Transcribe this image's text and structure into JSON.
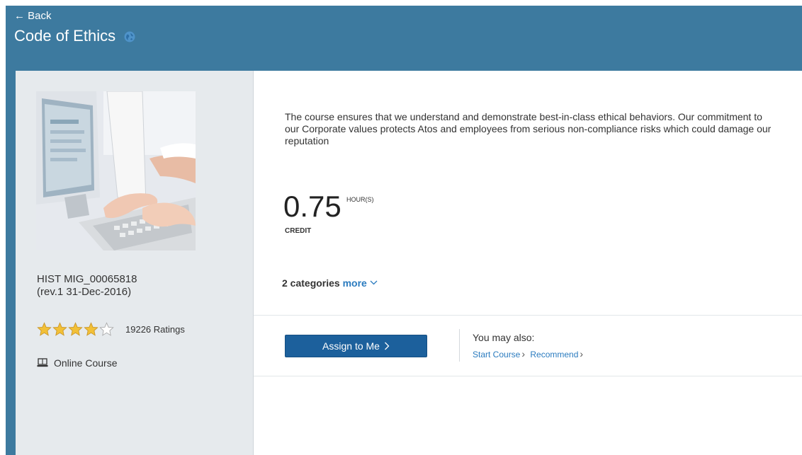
{
  "header": {
    "back_label": "← Back",
    "title": "Code of Ethics"
  },
  "course": {
    "id_line1": "HIST MIG_00065818",
    "id_line2": "(rev.1 31-Dec-2016)",
    "rating": {
      "value": 4,
      "max": 5,
      "count_label": "19226 Ratings"
    },
    "type_label": "Online Course"
  },
  "description": "The course ensures that we understand and demonstrate best-in-class ethical behaviors. Our commitment to our Corporate values protects Atos and employees from serious non-compliance risks which could damage our reputation",
  "credit": {
    "value": "0.75",
    "unit": "HOUR(S)",
    "label": "CREDIT"
  },
  "categories": {
    "label": "2 categories",
    "more_label": "more"
  },
  "actions": {
    "assign_label": "Assign to Me",
    "may_also_label": "You may also:",
    "start_course_label": "Start Course",
    "recommend_label": "Recommend"
  },
  "colors": {
    "header_bg": "#3d7a9f",
    "primary_button": "#1c609c",
    "link": "#2a7bbf",
    "star": "#f2c037"
  },
  "icons": [
    "back-arrow",
    "globe-icon",
    "star-icon",
    "online-course-icon",
    "chevron-down-icon",
    "chevron-right-icon"
  ]
}
